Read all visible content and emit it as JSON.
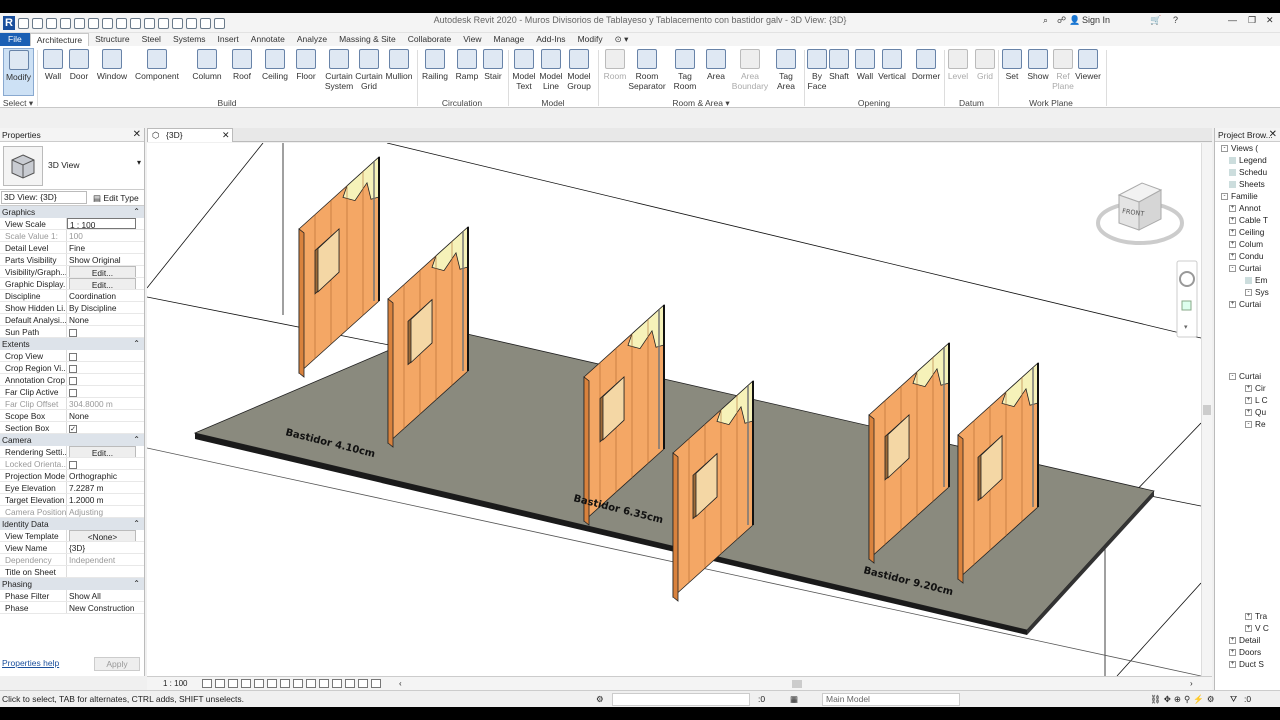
{
  "window": {
    "title": "Autodesk Revit 2020 - Muros Divisorios de Tablayeso y Tablacemento con bastidor galv - 3D View: {3D}",
    "sign_in": "Sign In"
  },
  "tabs": [
    "File",
    "Architecture",
    "Structure",
    "Steel",
    "Systems",
    "Insert",
    "Annotate",
    "Analyze",
    "Massing & Site",
    "Collaborate",
    "View",
    "Manage",
    "Add-Ins",
    "Modify"
  ],
  "ribbon": {
    "modify": "Modify",
    "select": "Select ▾",
    "build": {
      "label": "Build",
      "items": [
        "Wall",
        "Door",
        "Window",
        "Component",
        "Column",
        "Roof",
        "Ceiling",
        "Floor",
        "Curtain System",
        "Curtain Grid",
        "Mullion"
      ]
    },
    "circulation": {
      "label": "Circulation",
      "items": [
        "Railing",
        "Ramp",
        "Stair"
      ]
    },
    "model": {
      "label": "Model",
      "items": [
        "Model Text",
        "Model Line",
        "Model Group"
      ]
    },
    "room_area": {
      "label": "Room & Area ▾",
      "items": [
        "Room",
        "Room Separator",
        "Tag Room",
        "Area",
        "Area Boundary",
        "Tag Area"
      ]
    },
    "opening": {
      "label": "Opening",
      "items": [
        "By Face",
        "Shaft",
        "Wall",
        "Vertical",
        "Dormer"
      ]
    },
    "datum": {
      "label": "Datum",
      "items": [
        "Level",
        "Grid"
      ]
    },
    "work_plane": {
      "label": "Work Plane",
      "items": [
        "Set",
        "Show",
        "Ref Plane",
        "Viewer"
      ]
    }
  },
  "properties": {
    "title": "Properties",
    "type_name": "3D View",
    "view_selector": "3D View: {3D}",
    "edit_type": "Edit Type",
    "sections": [
      {
        "name": "Graphics",
        "rows": [
          [
            "View Scale",
            "1 : 100"
          ],
          [
            "Scale Value    1:",
            "100"
          ],
          [
            "Detail Level",
            "Fine"
          ],
          [
            "Parts Visibility",
            "Show Original"
          ],
          [
            "Visibility/Graph...",
            "Edit..."
          ],
          [
            "Graphic Display...",
            "Edit..."
          ],
          [
            "Discipline",
            "Coordination"
          ],
          [
            "Show Hidden Li...",
            "By Discipline"
          ],
          [
            "Default Analysi...",
            "None"
          ],
          [
            "Sun Path",
            ""
          ]
        ]
      },
      {
        "name": "Extents",
        "rows": [
          [
            "Crop View",
            ""
          ],
          [
            "Crop Region Vi...",
            ""
          ],
          [
            "Annotation Crop",
            ""
          ],
          [
            "Far Clip Active",
            ""
          ],
          [
            "Far Clip Offset",
            "304.8000 m"
          ],
          [
            "Scope Box",
            "None"
          ],
          [
            "Section Box",
            "✓"
          ]
        ]
      },
      {
        "name": "Camera",
        "rows": [
          [
            "Rendering Setti...",
            "Edit..."
          ],
          [
            "Locked Orienta...",
            ""
          ],
          [
            "Projection Mode",
            "Orthographic"
          ],
          [
            "Eye Elevation",
            "7.2287 m"
          ],
          [
            "Target Elevation",
            "1.2000 m"
          ],
          [
            "Camera Position",
            "Adjusting"
          ]
        ]
      },
      {
        "name": "Identity Data",
        "rows": [
          [
            "View Template",
            "<None>"
          ],
          [
            "View Name",
            "{3D}"
          ],
          [
            "Dependency",
            "Independent"
          ],
          [
            "Title on Sheet",
            ""
          ]
        ]
      },
      {
        "name": "Phasing",
        "rows": [
          [
            "Phase Filter",
            "Show All"
          ],
          [
            "Phase",
            "New Construction"
          ]
        ]
      }
    ],
    "help": "Properties help",
    "apply": "Apply"
  },
  "view": {
    "tab": "{3D}",
    "scale": "1 : 100",
    "viewcube_face": "FRONT",
    "labels": [
      "Bastidor 4.10cm",
      "Bastidor 6.35cm",
      "Bastidor 9.20cm"
    ]
  },
  "browser": {
    "title": "Project Brow...",
    "items": [
      "Views (",
      "Legend",
      "Schedu",
      "Sheets",
      "Familie",
      "Annot",
      "Cable T",
      "Ceiling",
      "Colum",
      "Condu",
      "Curtai",
      "Em",
      "Sys",
      "Curtai",
      "Curtai",
      "Cir",
      "L C",
      "Qu",
      "Re",
      "Tra",
      "V C",
      "Detail",
      "Doors",
      "Duct S"
    ]
  },
  "status": {
    "message": "Click to select, TAB for alternates, CTRL adds, SHIFT unselects.",
    "zero": ":0",
    "model": "Main Model"
  },
  "colors": {
    "wall": "#f4a765",
    "wall_dark": "#d9823d",
    "floor": "#8a8a7e",
    "accent": "#1a5fb4"
  }
}
